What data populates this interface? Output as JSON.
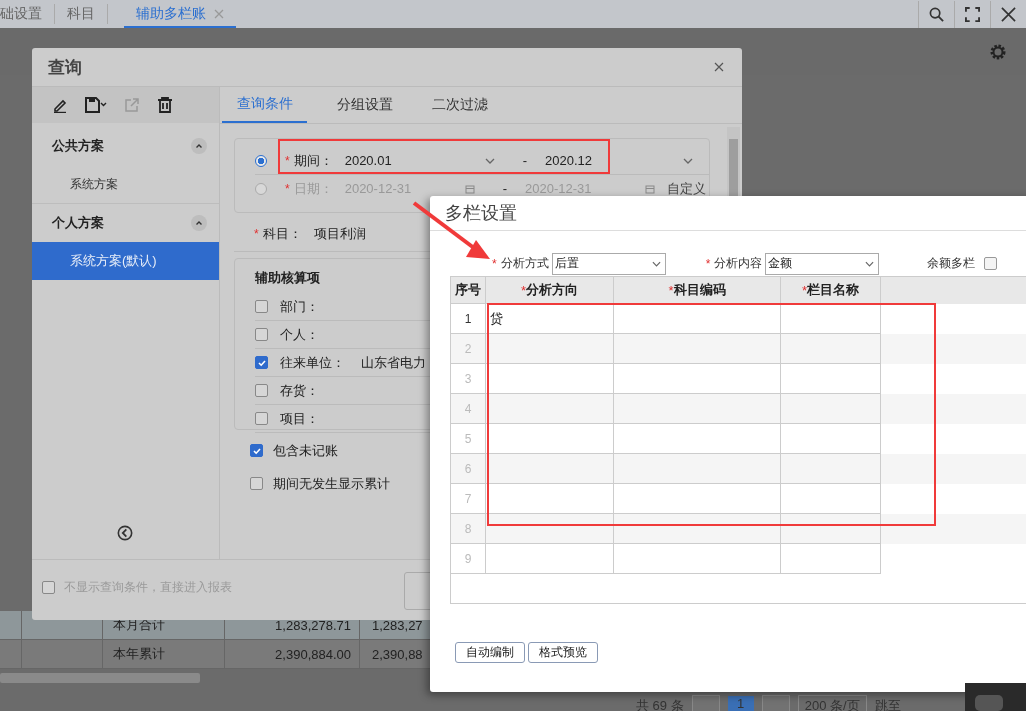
{
  "app_tabs": [
    {
      "label": "础设置",
      "selected": false,
      "closable": false
    },
    {
      "label": "科目",
      "selected": false,
      "closable": false
    },
    {
      "label": "辅助多栏账",
      "selected": true,
      "closable": true
    }
  ],
  "report_rows": [
    {
      "label": "本月合计",
      "amount": "1,283,278.71",
      "amount_2": "1,283,27",
      "highlighted": true
    },
    {
      "label": "本年累计",
      "amount": "2,390,884.00",
      "amount_2": "2,390,88",
      "highlighted": false
    }
  ],
  "pager": {
    "total": "共 69 条",
    "page": "1",
    "page_size": "200 条/页",
    "jump": "跳至"
  },
  "query_dialog": {
    "title": "查询",
    "sections": [
      {
        "title": "公共方案",
        "expanded": true,
        "items": [
          {
            "label": "系统方案",
            "selected": false
          }
        ]
      },
      {
        "title": "个人方案",
        "expanded": true,
        "items": [
          {
            "label": "系统方案(默认)",
            "selected": true
          }
        ]
      }
    ],
    "tabs": [
      {
        "label": "查询条件",
        "selected": true
      },
      {
        "label": "分组设置",
        "selected": false
      },
      {
        "label": "二次过滤",
        "selected": false
      }
    ],
    "period": {
      "selected": true,
      "marker": "*",
      "label": "期间：",
      "from": "2020.01",
      "separator": "-",
      "to": "2020.12"
    },
    "date": {
      "selected": false,
      "marker": "*",
      "label": "日期：",
      "from": "2020-12-31",
      "separator": "-",
      "to": "2020-12-31",
      "mode": "自定义"
    },
    "subject": {
      "marker": "*",
      "label": "科目：",
      "value": "项目利润"
    },
    "aux_title": "辅助核算项",
    "aux_items": [
      {
        "label": "部门：",
        "checked": false
      },
      {
        "label": "个人：",
        "checked": false
      },
      {
        "label": "往来单位：",
        "checked": true,
        "value": "山东省电力"
      },
      {
        "label": "存货：",
        "checked": false
      },
      {
        "label": "项目：",
        "checked": false
      }
    ],
    "options": [
      {
        "label": "包含未记账",
        "checked": true
      },
      {
        "label": "期间无发生显示累计",
        "checked": false
      }
    ],
    "footer_option": {
      "label": "不显示查询条件，直接进入报表",
      "checked": false
    }
  },
  "multi_dialog": {
    "title": "多栏设置",
    "fields": [
      {
        "marker": "*",
        "label": "分析方式",
        "value": "后置"
      },
      {
        "marker": "*",
        "label": "分析内容",
        "value": "金额"
      }
    ],
    "balance_option": {
      "label": "余额多栏",
      "checked": false
    },
    "columns": [
      {
        "label": "序号"
      },
      {
        "marker": "*",
        "label": "分析方向"
      },
      {
        "marker": "*",
        "label": "科目编码"
      },
      {
        "marker": "*",
        "label": "栏目名称"
      }
    ],
    "rows": [
      {
        "index": "1",
        "direction": "贷"
      },
      {
        "index": "2"
      },
      {
        "index": "3"
      },
      {
        "index": "4"
      },
      {
        "index": "5"
      },
      {
        "index": "6"
      },
      {
        "index": "7"
      },
      {
        "index": "8"
      },
      {
        "index": "9"
      }
    ],
    "buttons": [
      "自动编制",
      "格式预览"
    ]
  }
}
